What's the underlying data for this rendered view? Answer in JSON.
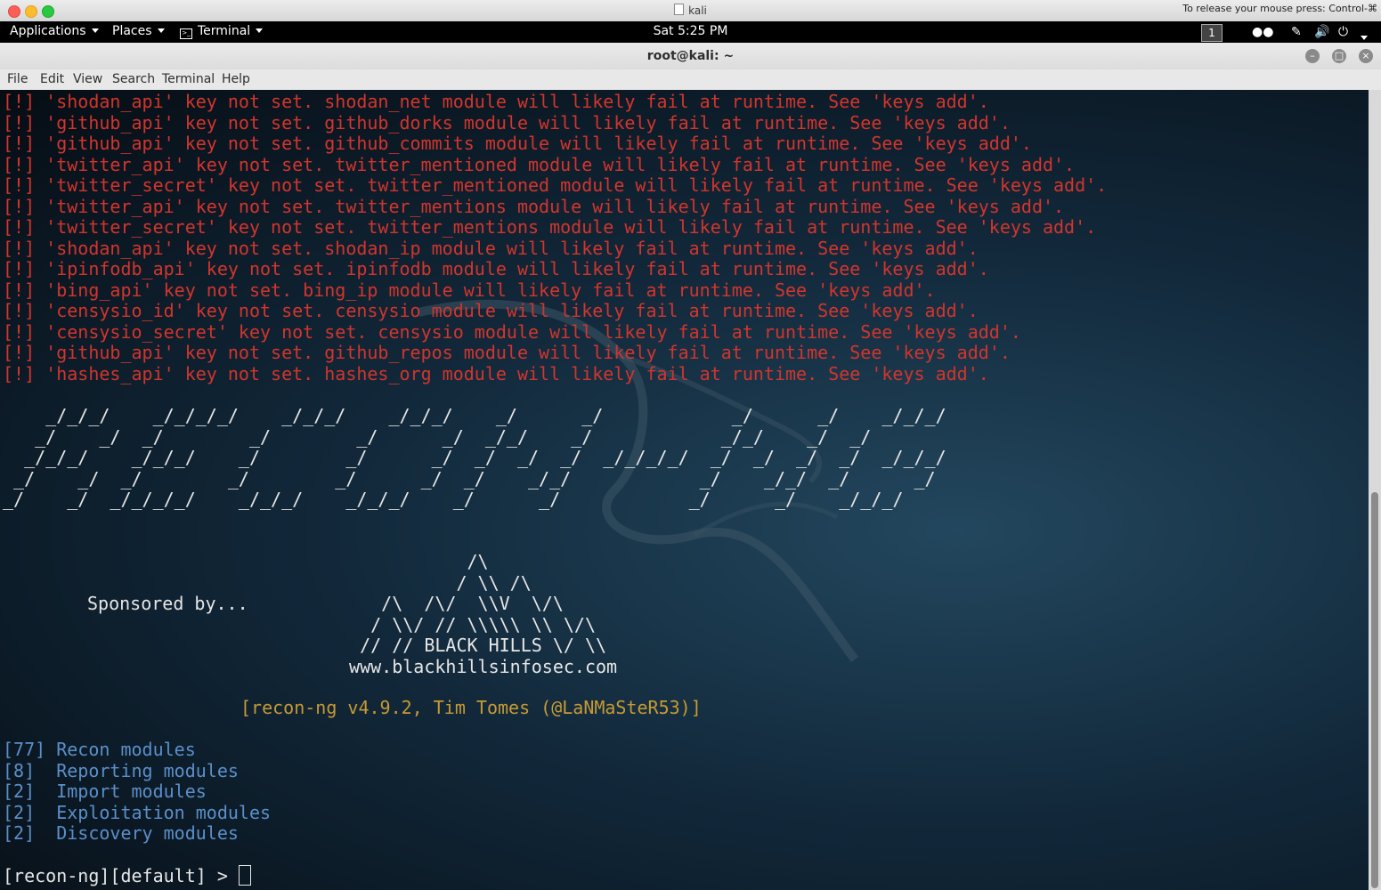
{
  "mac": {
    "title": "kali",
    "release_hint": "To release your mouse press: Control-⌘"
  },
  "panel": {
    "applications": "Applications",
    "places": "Places",
    "terminal": "Terminal",
    "clock": "Sat  5:25 PM",
    "workspace": "1"
  },
  "window": {
    "title": "root@kali: ~",
    "menu": [
      "File",
      "Edit",
      "View",
      "Search",
      "Terminal",
      "Help"
    ]
  },
  "terminal": {
    "warnings": [
      "[!] 'shodan_api' key not set. shodan_net module will likely fail at runtime. See 'keys add'.",
      "[!] 'github_api' key not set. github_dorks module will likely fail at runtime. See 'keys add'.",
      "[!] 'github_api' key not set. github_commits module will likely fail at runtime. See 'keys add'.",
      "[!] 'twitter_api' key not set. twitter_mentioned module will likely fail at runtime. See 'keys add'.",
      "[!] 'twitter_secret' key not set. twitter_mentioned module will likely fail at runtime. See 'keys add'.",
      "[!] 'twitter_api' key not set. twitter_mentions module will likely fail at runtime. See 'keys add'.",
      "[!] 'twitter_secret' key not set. twitter_mentions module will likely fail at runtime. See 'keys add'.",
      "[!] 'shodan_api' key not set. shodan_ip module will likely fail at runtime. See 'keys add'.",
      "[!] 'ipinfodb_api' key not set. ipinfodb module will likely fail at runtime. See 'keys add'.",
      "[!] 'bing_api' key not set. bing_ip module will likely fail at runtime. See 'keys add'.",
      "[!] 'censysio_id' key not set. censysio module will likely fail at runtime. See 'keys add'.",
      "[!] 'censysio_secret' key not set. censysio module will likely fail at runtime. See 'keys add'.",
      "[!] 'github_api' key not set. github_repos module will likely fail at runtime. See 'keys add'.",
      "[!] 'hashes_api' key not set. hashes_org module will likely fail at runtime. See 'keys add'."
    ],
    "banner": [
      "    _/_/_/    _/_/_/_/    _/_/_/    _/_/_/    _/      _/            _/      _/    _/_/_/",
      "   _/    _/  _/        _/        _/      _/  _/_/    _/            _/_/    _/  _/",
      "  _/_/_/    _/_/_/    _/        _/      _/  _/  _/  _/  _/_/_/_/  _/  _/  _/  _/  _/_/_/",
      " _/    _/  _/        _/        _/      _/  _/    _/_/            _/    _/_/  _/      _/",
      "_/    _/  _/_/_/_/    _/_/_/    _/_/_/    _/      _/            _/      _/    _/_/_/"
    ],
    "sponsor": "Sponsored by...",
    "logo": [
      "            /\\",
      "           / \\\\ /\\",
      "    /\\  /\\/  \\\\V  \\/\\",
      "   / \\\\/ // \\\\\\\\\\ \\\\ \\/\\",
      "  // // BLACK HILLS \\/ \\\\",
      " www.blackhillsinfosec.com"
    ],
    "version": "[recon-ng v4.9.2, Tim Tomes (@LaNMaSteR53)]",
    "modules": [
      "[77] Recon modules",
      "[8]  Reporting modules",
      "[2]  Import modules",
      "[2]  Exploitation modules",
      "[2]  Discovery modules"
    ],
    "prompt": "[recon-ng][default] > "
  },
  "colors": {
    "warning": "#d2352d",
    "version": "#c79a33",
    "modules": "#5b8fc9",
    "text": "#e6e6e6"
  }
}
